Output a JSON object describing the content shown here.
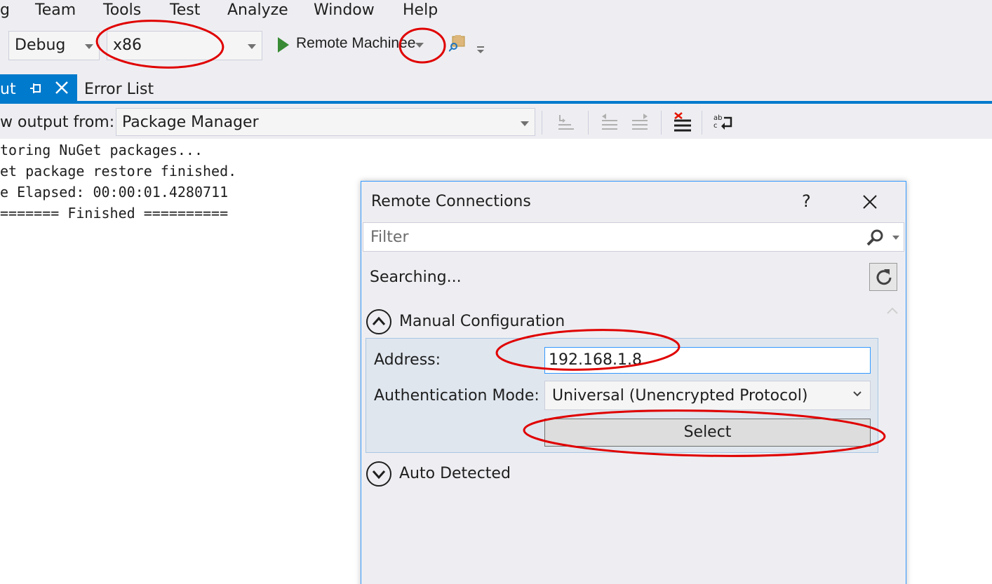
{
  "menu": {
    "items": [
      "g",
      "Team",
      "Tools",
      "Test",
      "Analyze",
      "Window",
      "Help"
    ]
  },
  "toolbar": {
    "configuration": "Debug",
    "platform": "x86",
    "run_target": "Remote Machinee"
  },
  "tabs": {
    "active_label": "ut",
    "inactive_label": "Error List"
  },
  "output": {
    "show_from_label": "w output from:",
    "source": "Package Manager",
    "lines": [
      "toring NuGet packages...",
      "et package restore finished.",
      "e Elapsed: 00:00:01.4280711",
      "======= Finished =========="
    ]
  },
  "dialog": {
    "title": "Remote Connections",
    "help": "?",
    "filter_placeholder": "Filter",
    "status": "Searching...",
    "manual_section": "Manual Configuration",
    "address_label": "Address:",
    "address_value": "192.168.1.8",
    "auth_label": "Authentication Mode:",
    "auth_value": "Universal (Unencrypted Protocol)",
    "select_label": "Select",
    "auto_section": "Auto Detected"
  },
  "colors": {
    "accent": "#007acc",
    "annotation": "#e00000",
    "run_green": "#388a34"
  },
  "icons": [
    "play-icon",
    "folder-search-icon",
    "pin-icon",
    "close-icon",
    "search-icon",
    "refresh-icon",
    "chevron-up-icon",
    "chevron-down-icon",
    "word-wrap-icon",
    "clear-all-icon"
  ]
}
